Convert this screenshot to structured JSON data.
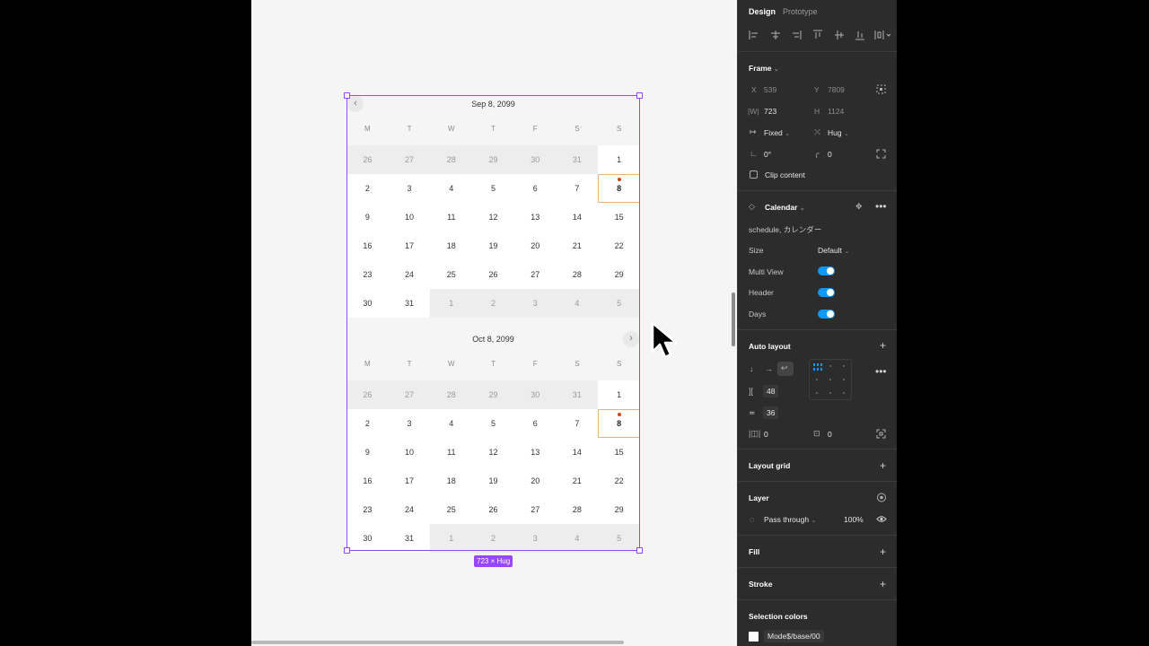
{
  "months": [
    {
      "title": "Sep 8, 2099",
      "weekdays": [
        "M",
        "T",
        "W",
        "T",
        "F",
        "S",
        "S"
      ],
      "days": [
        {
          "d": "26",
          "m": true
        },
        {
          "d": "27",
          "m": true
        },
        {
          "d": "28",
          "m": true
        },
        {
          "d": "29",
          "m": true
        },
        {
          "d": "30",
          "m": true
        },
        {
          "d": "31",
          "m": true
        },
        {
          "d": "1"
        },
        {
          "d": "2"
        },
        {
          "d": "3"
        },
        {
          "d": "4"
        },
        {
          "d": "5"
        },
        {
          "d": "6"
        },
        {
          "d": "7"
        },
        {
          "d": "8",
          "today": true
        },
        {
          "d": "9"
        },
        {
          "d": "10"
        },
        {
          "d": "11"
        },
        {
          "d": "12"
        },
        {
          "d": "13"
        },
        {
          "d": "14"
        },
        {
          "d": "15"
        },
        {
          "d": "16"
        },
        {
          "d": "17"
        },
        {
          "d": "18"
        },
        {
          "d": "19"
        },
        {
          "d": "20"
        },
        {
          "d": "21"
        },
        {
          "d": "22"
        },
        {
          "d": "23"
        },
        {
          "d": "24"
        },
        {
          "d": "25"
        },
        {
          "d": "26"
        },
        {
          "d": "27"
        },
        {
          "d": "28"
        },
        {
          "d": "29"
        },
        {
          "d": "30"
        },
        {
          "d": "31"
        },
        {
          "d": "1",
          "m": true
        },
        {
          "d": "2",
          "m": true
        },
        {
          "d": "3",
          "m": true
        },
        {
          "d": "4",
          "m": true
        },
        {
          "d": "5",
          "m": true
        }
      ]
    },
    {
      "title": "Oct 8, 2099",
      "weekdays": [
        "M",
        "T",
        "W",
        "T",
        "F",
        "S",
        "S"
      ],
      "days": [
        {
          "d": "26",
          "m": true
        },
        {
          "d": "27",
          "m": true
        },
        {
          "d": "28",
          "m": true
        },
        {
          "d": "29",
          "m": true
        },
        {
          "d": "30",
          "m": true
        },
        {
          "d": "31",
          "m": true
        },
        {
          "d": "1"
        },
        {
          "d": "2"
        },
        {
          "d": "3"
        },
        {
          "d": "4"
        },
        {
          "d": "5"
        },
        {
          "d": "6"
        },
        {
          "d": "7"
        },
        {
          "d": "8",
          "today": true
        },
        {
          "d": "9"
        },
        {
          "d": "10"
        },
        {
          "d": "11"
        },
        {
          "d": "12"
        },
        {
          "d": "13"
        },
        {
          "d": "14"
        },
        {
          "d": "15"
        },
        {
          "d": "16"
        },
        {
          "d": "17"
        },
        {
          "d": "18"
        },
        {
          "d": "19"
        },
        {
          "d": "20"
        },
        {
          "d": "21"
        },
        {
          "d": "22"
        },
        {
          "d": "23"
        },
        {
          "d": "24"
        },
        {
          "d": "25"
        },
        {
          "d": "26"
        },
        {
          "d": "27"
        },
        {
          "d": "28"
        },
        {
          "d": "29"
        },
        {
          "d": "30"
        },
        {
          "d": "31"
        },
        {
          "d": "1",
          "m": true
        },
        {
          "d": "2",
          "m": true
        },
        {
          "d": "3",
          "m": true
        },
        {
          "d": "4",
          "m": true
        },
        {
          "d": "5",
          "m": true
        }
      ]
    }
  ],
  "canvas": {
    "size_badge": "723 × Hug",
    "nav_prev": "‹",
    "nav_next": "›",
    "selection_color": "#9747ff",
    "today_dot_color": "#c64a19"
  },
  "panel": {
    "tabs": {
      "design": "Design",
      "prototype": "Prototype"
    },
    "frame": {
      "title": "Frame",
      "x_label": "X",
      "x_value": "539",
      "y_label": "Y",
      "y_value": "7809",
      "w_label": "|W|",
      "w_value": "723",
      "h_label": "H",
      "h_value": "1124",
      "w_mode": "Fixed",
      "h_mode": "Hug",
      "rotation": "0°",
      "radius": "0",
      "clip_label": "Clip content"
    },
    "component": {
      "name": "Calendar",
      "description": "schedule, カレンダー",
      "props": [
        {
          "label": "Size",
          "value": "Default",
          "type": "select"
        },
        {
          "label": "Multi View",
          "value": "on",
          "type": "toggle"
        },
        {
          "label": "Header",
          "value": "on",
          "type": "toggle"
        },
        {
          "label": "Days",
          "value": "on",
          "type": "toggle"
        }
      ]
    },
    "auto_layout": {
      "title": "Auto layout",
      "gap_h": "48",
      "gap_v": "36",
      "padding_h": "0",
      "padding_v": "0"
    },
    "layout_grid": {
      "title": "Layout grid"
    },
    "layer": {
      "title": "Layer",
      "blend": "Pass through",
      "opacity": "100%"
    },
    "fill": {
      "title": "Fill"
    },
    "stroke": {
      "title": "Stroke"
    },
    "selection_colors": {
      "title": "Selection colors",
      "color_name": "Mode$/base/00"
    },
    "accent": "#0d99ff"
  }
}
